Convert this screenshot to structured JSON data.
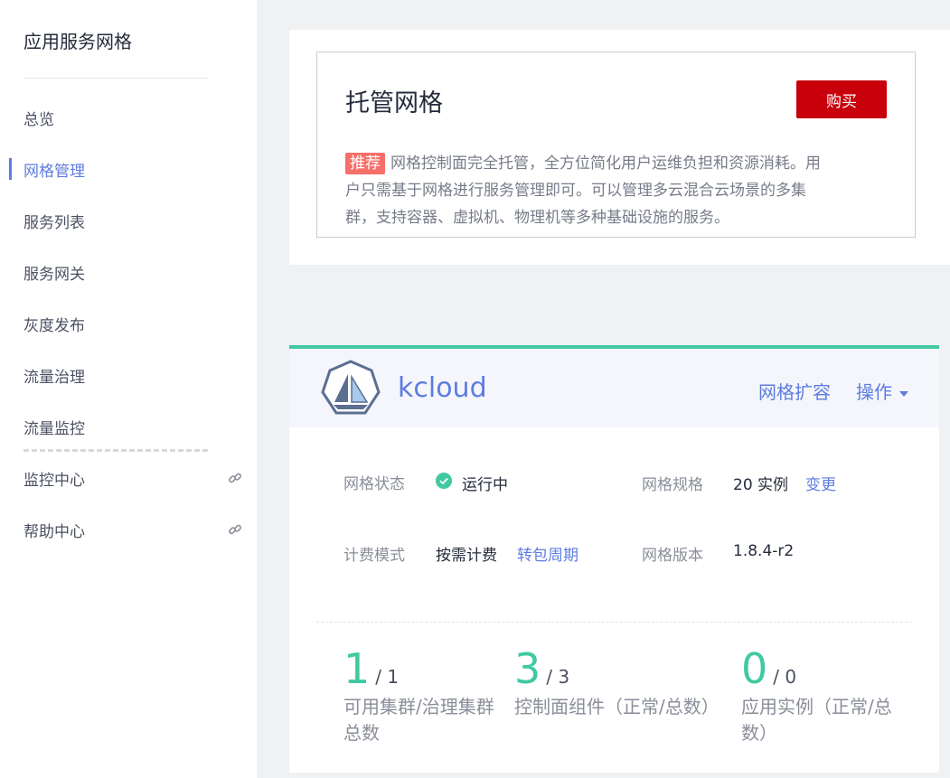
{
  "sidebar": {
    "title": "应用服务网格",
    "items": [
      {
        "label": "总览"
      },
      {
        "label": "网格管理"
      },
      {
        "label": "服务列表"
      },
      {
        "label": "服务网关"
      },
      {
        "label": "灰度发布"
      },
      {
        "label": "流量治理"
      },
      {
        "label": "流量监控"
      },
      {
        "label": "监控中心"
      },
      {
        "label": "帮助中心"
      }
    ]
  },
  "promo": {
    "title": "托管网格",
    "buy_label": "购买",
    "badge": "推荐",
    "description": "网格控制面完全托管，全方位简化用户运维负担和资源消耗。用户只需基于网格进行服务管理即可。可以管理多云混合云场景的多集群，支持容器、虚拟机、物理机等多种基础设施的服务。"
  },
  "mesh": {
    "name": "kcloud",
    "scale_label": "网格扩容",
    "ops_label": "操作",
    "status_label": "网格状态",
    "status_value": "运行中",
    "spec_label": "网格规格",
    "spec_value": "20 实例",
    "spec_change": "变更",
    "billing_label": "计费模式",
    "billing_value": "按需计费",
    "billing_link": "转包周期",
    "version_label": "网格版本",
    "version_value": "1.8.4-r2",
    "stats": [
      {
        "value": "1",
        "total": "/ 1",
        "label": "可用集群/治理集群总数"
      },
      {
        "value": "3",
        "total": "/ 3",
        "label": "控制面组件（正常/总数）"
      },
      {
        "value": "0",
        "total": "/ 0",
        "label": "应用实例（正常/总数）"
      }
    ]
  },
  "colors": {
    "accent": "#5e7ce0",
    "success": "#40c9a2",
    "buy": "#c7000b",
    "badge": "#f66f6a"
  }
}
